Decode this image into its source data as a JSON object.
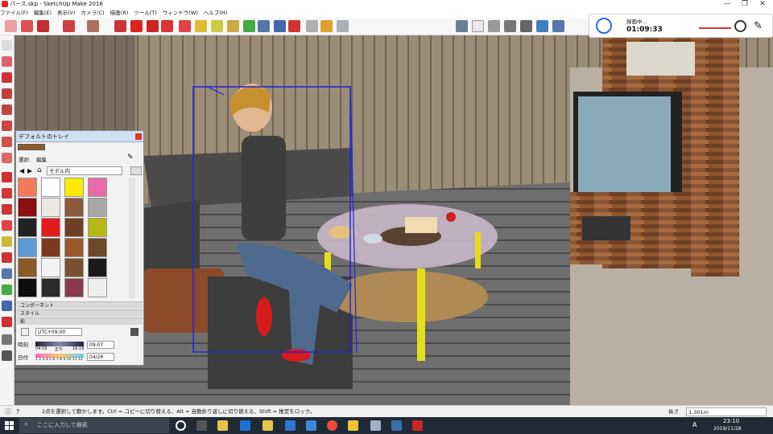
{
  "window": {
    "title": "パース.skp - SketchUp Make 2016",
    "min_glyph": "—",
    "max_glyph": "❐",
    "close_glyph": "✕"
  },
  "menu": [
    "ファイル(F)",
    "編集(E)",
    "表示(V)",
    "カメラ(C)",
    "描画(R)",
    "ツール(T)",
    "ウィンドウ(W)",
    "ヘルプ(H)"
  ],
  "tray": {
    "title": "デフォルトのトレイ",
    "tabs": [
      "選択",
      "編集"
    ],
    "material_select": "モデル内",
    "sections": [
      "コンポーネント",
      "スタイル",
      "影"
    ],
    "shadow": {
      "timezone": "UTC+09:00",
      "time_label": "時刻",
      "time_min": "04:59",
      "time_mid": "正午",
      "time_max": "18:18",
      "time_value": "09:07",
      "date_label": "日付",
      "months": "1 2 3 4 5 6 7 8 9 10 11 12",
      "date_value": "04/26"
    }
  },
  "recorder": {
    "status": "録画中...",
    "time": "01:09:33"
  },
  "status_bar": {
    "hint": "2点を選択して動かします。Ctrl = コピーに切り替える、Alt = 自動折り返しに切り替える、Shift = 推定をロック。",
    "length_label": "長さ",
    "length_value": "1.301m"
  },
  "taskbar": {
    "search_placeholder": "ここに入力して検索",
    "time": "23:10",
    "date": "2019/11/28",
    "ime": "A"
  },
  "colors": {
    "swatches": [
      "#f07a5a",
      "#ffffff",
      "#ffeb00",
      "#e86aa6",
      "#8b0f0f",
      "#ece9e2",
      "#8a5a3a",
      "#a8a8a8",
      "#222222",
      "#e41b1b",
      "#6e3f24",
      "#b7b915",
      "#5b9bd5",
      "#7b3b1c",
      "#9a5a2a",
      "#6b4a2a",
      "#8a5a2a",
      "#f4f4f4",
      "#7a5030",
      "#1a1a1a",
      "#0c0c0c",
      "#2a2a2a",
      "#8a3a4a",
      "#eeeeee"
    ]
  }
}
